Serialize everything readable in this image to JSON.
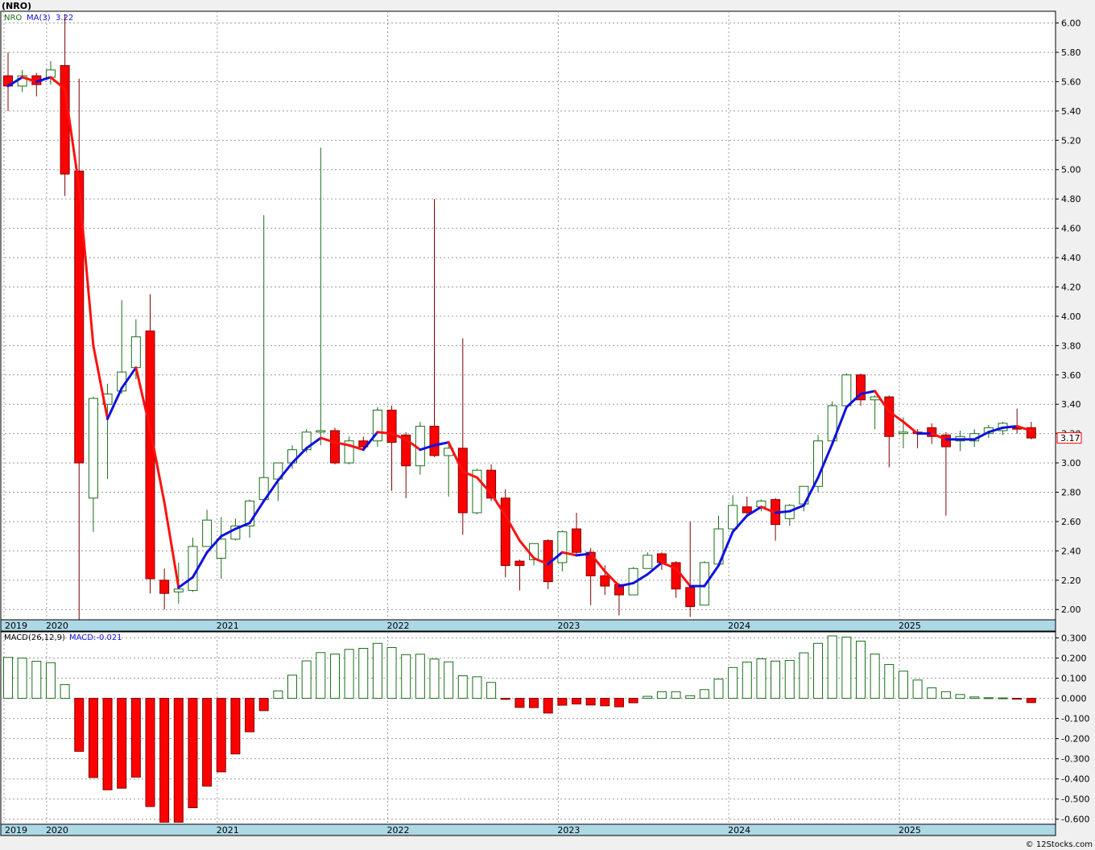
{
  "chart_data": [
    {
      "type": "candlestick",
      "ticker_label": "(NRO)",
      "legend": {
        "symbol": "NRO",
        "ma_label": "MA(3)",
        "ma_value": "3.22"
      },
      "last_price_label": "3.17",
      "y_ticks": [
        "2.00",
        "2.20",
        "2.40",
        "2.60",
        "2.80",
        "3.00",
        "3.20",
        "3.40",
        "3.60",
        "3.80",
        "4.00",
        "4.20",
        "4.40",
        "4.60",
        "4.80",
        "5.00",
        "5.20",
        "5.40",
        "5.60",
        "5.80",
        "6.00"
      ],
      "ylim": [
        1.93,
        6.08
      ],
      "x_labels": [
        {
          "label": "2019",
          "index": -0.5
        },
        {
          "label": "2020",
          "index": 2.5
        },
        {
          "label": "2021",
          "index": 14.5
        },
        {
          "label": "2022",
          "index": 26.5
        },
        {
          "label": "2023",
          "index": 38.5
        },
        {
          "label": "2024",
          "index": 50.5
        },
        {
          "label": "2025",
          "index": 62.5
        }
      ],
      "candles": [
        {
          "o": 5.64,
          "h": 5.8,
          "l": 5.4,
          "c": 5.57
        },
        {
          "o": 5.57,
          "h": 5.68,
          "l": 5.53,
          "c": 5.64
        },
        {
          "o": 5.64,
          "h": 5.66,
          "l": 5.5,
          "c": 5.58
        },
        {
          "o": 5.63,
          "h": 5.74,
          "l": 5.58,
          "c": 5.68
        },
        {
          "o": 5.71,
          "h": 6.06,
          "l": 4.82,
          "c": 4.97
        },
        {
          "o": 4.99,
          "h": 5.62,
          "l": 1.93,
          "c": 3.0
        },
        {
          "o": 2.76,
          "h": 3.45,
          "l": 2.53,
          "c": 3.44
        },
        {
          "o": 3.4,
          "h": 3.54,
          "l": 2.89,
          "c": 3.47
        },
        {
          "o": 3.49,
          "h": 4.11,
          "l": 3.47,
          "c": 3.62
        },
        {
          "o": 3.65,
          "h": 3.98,
          "l": 3.57,
          "c": 3.86
        },
        {
          "o": 3.9,
          "h": 4.15,
          "l": 2.11,
          "c": 2.21
        },
        {
          "o": 2.2,
          "h": 2.28,
          "l": 2.0,
          "c": 2.11
        },
        {
          "o": 2.12,
          "h": 2.32,
          "l": 2.04,
          "c": 2.14
        },
        {
          "o": 2.13,
          "h": 2.49,
          "l": 2.12,
          "c": 2.43
        },
        {
          "o": 2.43,
          "h": 2.68,
          "l": 2.43,
          "c": 2.61
        },
        {
          "o": 2.35,
          "h": 2.63,
          "l": 2.21,
          "c": 2.48
        },
        {
          "o": 2.48,
          "h": 2.62,
          "l": 2.47,
          "c": 2.57
        },
        {
          "o": 2.57,
          "h": 2.75,
          "l": 2.49,
          "c": 2.74
        },
        {
          "o": 2.75,
          "h": 4.69,
          "l": 2.73,
          "c": 2.9
        },
        {
          "o": 2.89,
          "h": 3.0,
          "l": 2.74,
          "c": 3.0
        },
        {
          "o": 3.0,
          "h": 3.12,
          "l": 2.96,
          "c": 3.09
        },
        {
          "o": 3.09,
          "h": 3.23,
          "l": 3.07,
          "c": 3.21
        },
        {
          "o": 3.21,
          "h": 5.15,
          "l": 3.12,
          "c": 3.22
        },
        {
          "o": 3.22,
          "h": 3.24,
          "l": 2.99,
          "c": 3.0
        },
        {
          "o": 3.0,
          "h": 3.18,
          "l": 2.99,
          "c": 3.15
        },
        {
          "o": 3.15,
          "h": 3.18,
          "l": 3.09,
          "c": 3.11
        },
        {
          "o": 3.15,
          "h": 3.38,
          "l": 3.11,
          "c": 3.36
        },
        {
          "o": 3.36,
          "h": 3.39,
          "l": 2.81,
          "c": 3.14
        },
        {
          "o": 3.19,
          "h": 3.21,
          "l": 2.76,
          "c": 2.98
        },
        {
          "o": 2.98,
          "h": 3.28,
          "l": 2.92,
          "c": 3.25
        },
        {
          "o": 3.25,
          "h": 4.8,
          "l": 3.04,
          "c": 3.05
        },
        {
          "o": 3.05,
          "h": 3.15,
          "l": 2.77,
          "c": 3.1
        },
        {
          "o": 3.1,
          "h": 3.85,
          "l": 2.51,
          "c": 2.66
        },
        {
          "o": 2.66,
          "h": 2.96,
          "l": 2.65,
          "c": 2.95
        },
        {
          "o": 2.95,
          "h": 2.99,
          "l": 2.74,
          "c": 2.76
        },
        {
          "o": 2.76,
          "h": 2.82,
          "l": 2.22,
          "c": 2.3
        },
        {
          "o": 2.33,
          "h": 2.34,
          "l": 2.13,
          "c": 2.3
        },
        {
          "o": 2.34,
          "h": 2.45,
          "l": 2.3,
          "c": 2.45
        },
        {
          "o": 2.47,
          "h": 2.48,
          "l": 2.14,
          "c": 2.19
        },
        {
          "o": 2.32,
          "h": 2.54,
          "l": 2.26,
          "c": 2.53
        },
        {
          "o": 2.55,
          "h": 2.66,
          "l": 2.38,
          "c": 2.39
        },
        {
          "o": 2.39,
          "h": 2.42,
          "l": 2.03,
          "c": 2.23
        },
        {
          "o": 2.23,
          "h": 2.3,
          "l": 2.1,
          "c": 2.16
        },
        {
          "o": 2.17,
          "h": 2.18,
          "l": 1.96,
          "c": 2.1
        },
        {
          "o": 2.1,
          "h": 2.29,
          "l": 2.1,
          "c": 2.28
        },
        {
          "o": 2.28,
          "h": 2.39,
          "l": 2.28,
          "c": 2.37
        },
        {
          "o": 2.38,
          "h": 2.39,
          "l": 2.27,
          "c": 2.32
        },
        {
          "o": 2.32,
          "h": 2.33,
          "l": 2.08,
          "c": 2.14
        },
        {
          "o": 2.15,
          "h": 2.6,
          "l": 1.95,
          "c": 2.02
        },
        {
          "o": 2.03,
          "h": 2.33,
          "l": 2.03,
          "c": 2.32
        },
        {
          "o": 2.31,
          "h": 2.64,
          "l": 2.31,
          "c": 2.55
        },
        {
          "o": 2.55,
          "h": 2.78,
          "l": 2.53,
          "c": 2.71
        },
        {
          "o": 2.7,
          "h": 2.77,
          "l": 2.65,
          "c": 2.66
        },
        {
          "o": 2.7,
          "h": 2.75,
          "l": 2.67,
          "c": 2.74
        },
        {
          "o": 2.75,
          "h": 2.76,
          "l": 2.47,
          "c": 2.58
        },
        {
          "o": 2.62,
          "h": 2.72,
          "l": 2.57,
          "c": 2.71
        },
        {
          "o": 2.72,
          "h": 2.84,
          "l": 2.67,
          "c": 2.84
        },
        {
          "o": 2.84,
          "h": 3.19,
          "l": 2.8,
          "c": 3.15
        },
        {
          "o": 3.15,
          "h": 3.42,
          "l": 3.13,
          "c": 3.39
        },
        {
          "o": 3.39,
          "h": 3.61,
          "l": 3.37,
          "c": 3.6
        },
        {
          "o": 3.6,
          "h": 3.61,
          "l": 3.39,
          "c": 3.43
        },
        {
          "o": 3.43,
          "h": 3.46,
          "l": 3.23,
          "c": 3.45
        },
        {
          "o": 3.45,
          "h": 3.46,
          "l": 2.97,
          "c": 3.18
        },
        {
          "o": 3.2,
          "h": 3.31,
          "l": 3.1,
          "c": 3.21
        },
        {
          "o": 3.21,
          "h": 3.23,
          "l": 3.1,
          "c": 3.2
        },
        {
          "o": 3.24,
          "h": 3.27,
          "l": 3.13,
          "c": 3.18
        },
        {
          "o": 3.19,
          "h": 3.21,
          "l": 2.64,
          "c": 3.11
        },
        {
          "o": 3.15,
          "h": 3.22,
          "l": 3.08,
          "c": 3.18
        },
        {
          "o": 3.15,
          "h": 3.23,
          "l": 3.11,
          "c": 3.2
        },
        {
          "o": 3.2,
          "h": 3.26,
          "l": 3.17,
          "c": 3.24
        },
        {
          "o": 3.22,
          "h": 3.28,
          "l": 3.19,
          "c": 3.27
        },
        {
          "o": 3.24,
          "h": 3.37,
          "l": 3.2,
          "c": 3.23
        },
        {
          "o": 3.24,
          "h": 3.28,
          "l": 3.16,
          "c": 3.17
        }
      ],
      "ma3": [
        5.57,
        5.63,
        5.6,
        5.63,
        5.55,
        4.88,
        3.8,
        3.3,
        3.51,
        3.65,
        3.23,
        2.73,
        2.15,
        2.22,
        2.39,
        2.5,
        2.55,
        2.59,
        2.74,
        2.88,
        3.0,
        3.1,
        3.17,
        3.14,
        3.12,
        3.09,
        3.21,
        3.2,
        3.16,
        3.09,
        3.12,
        3.14,
        2.94,
        2.9,
        2.79,
        2.64,
        2.47,
        2.35,
        2.31,
        2.39,
        2.37,
        2.38,
        2.26,
        2.16,
        2.18,
        2.24,
        2.32,
        2.28,
        2.16,
        2.16,
        2.3,
        2.53,
        2.64,
        2.7,
        2.66,
        2.67,
        2.71,
        2.9,
        3.13,
        3.38,
        3.47,
        3.49,
        3.35,
        3.28,
        3.2,
        3.2,
        3.16,
        3.16,
        3.16,
        3.21,
        3.24,
        3.25,
        3.22
      ],
      "ma3_color_up": "#1010e0",
      "ma3_color_down": "#ff1010",
      "candle_up_fill": "#ffffff",
      "candle_up_stroke": "#1a6e1a",
      "candle_down_fill": "#ff0000",
      "candle_down_stroke": "#800000"
    },
    {
      "type": "bar",
      "legend": {
        "label": "MACD(26,12,9)",
        "value_label": "MACD:-0.021"
      },
      "y_ticks": [
        "-0.600",
        "-0.500",
        "-0.400",
        "-0.300",
        "-0.200",
        "-0.100",
        "0.000",
        "0.100",
        "0.200",
        "0.300"
      ],
      "ylim": [
        -0.625,
        0.33
      ],
      "x_labels": [
        {
          "label": "2019",
          "index": -0.5
        },
        {
          "label": "2020",
          "index": 2.5
        },
        {
          "label": "2021",
          "index": 14.5
        },
        {
          "label": "2022",
          "index": 26.5
        },
        {
          "label": "2023",
          "index": 38.5
        },
        {
          "label": "2024",
          "index": 50.5
        },
        {
          "label": "2025",
          "index": 62.5
        }
      ],
      "values": [
        0.203,
        0.2,
        0.184,
        0.177,
        0.068,
        -0.263,
        -0.393,
        -0.454,
        -0.446,
        -0.391,
        -0.537,
        -0.615,
        -0.615,
        -0.543,
        -0.436,
        -0.365,
        -0.276,
        -0.166,
        -0.061,
        0.037,
        0.115,
        0.186,
        0.227,
        0.22,
        0.243,
        0.248,
        0.273,
        0.252,
        0.217,
        0.219,
        0.195,
        0.181,
        0.112,
        0.107,
        0.079,
        -0.005,
        -0.045,
        -0.046,
        -0.073,
        -0.034,
        -0.028,
        -0.033,
        -0.037,
        -0.042,
        -0.022,
        0.01,
        0.033,
        0.033,
        0.013,
        0.043,
        0.095,
        0.153,
        0.18,
        0.196,
        0.185,
        0.188,
        0.226,
        0.273,
        0.31,
        0.304,
        0.284,
        0.22,
        0.168,
        0.135,
        0.091,
        0.052,
        0.033,
        0.019,
        0.007,
        0.003,
        0.002,
        -0.003,
        -0.021
      ],
      "bar_up_fill": "#ffffff",
      "bar_up_stroke": "#1a6e1a",
      "bar_down_fill": "#ff0000",
      "bar_down_stroke": "#800000"
    }
  ],
  "watermark": "© 12Stocks.com"
}
